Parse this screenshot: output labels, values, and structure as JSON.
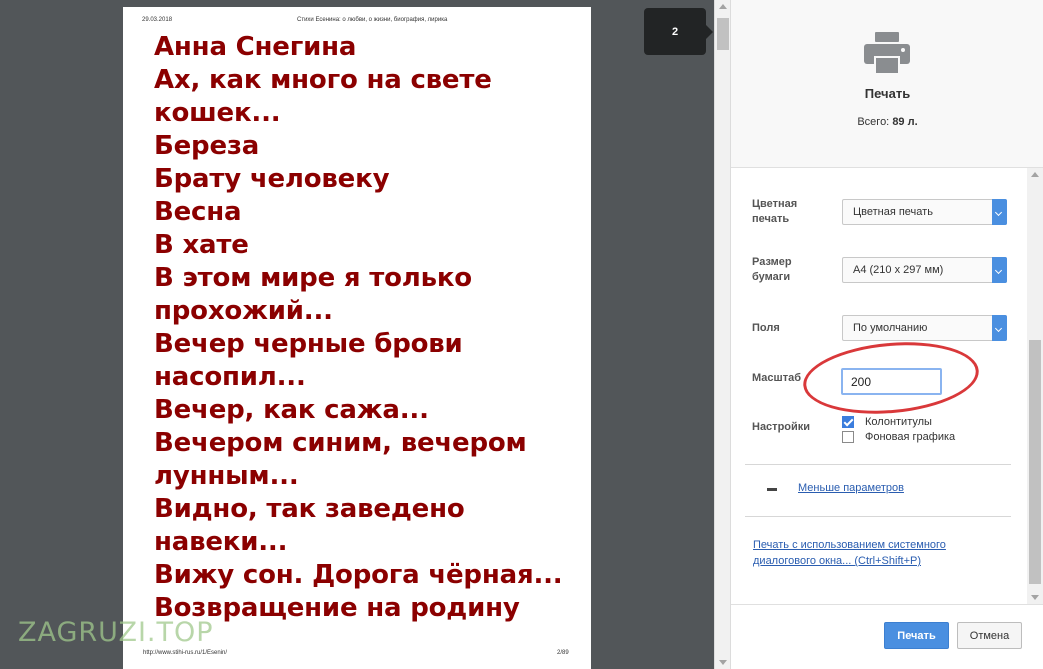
{
  "preview": {
    "header_date": "29.03.2018",
    "header_title": "Стихи Есенина: о любви, о жизни, биография, лирика",
    "poems": [
      "Анна Снегина",
      "Ах, как много на свете",
      "кошек...",
      "Береза",
      "Брату человеку",
      "Весна",
      "В хате",
      "В этом мире я только",
      "прохожий...",
      "Вечер черные брови",
      "насопил...",
      "Вечер, как сажа...",
      "Вечером синим, вечером",
      "лунным...",
      "Видно, так заведено",
      "навеки...",
      "Вижу сон. Дорога чёрная...",
      "Возвращение на родину"
    ],
    "footer_url": "http://www.stihi-rus.ru/1/Esenin/",
    "footer_page": "2/89",
    "page_badge": "2",
    "watermark": "ZAGRUZI.TOP",
    "text_color": "#8b0000"
  },
  "sidebar": {
    "icon": "printer-icon",
    "title": "Печать",
    "total_label": "Всего:",
    "total_value": "89 л.",
    "color_label": "Цветная печать",
    "color_value": "Цветная печать",
    "paper_label": "Размер бумаги",
    "paper_value": "A4 (210 x 297 мм)",
    "margins_label": "Поля",
    "margins_value": "По умолчанию",
    "scale_label": "Масштаб",
    "scale_value": "200",
    "settings_label": "Настройки",
    "opt_headers": "Колонтитулы",
    "opt_headers_checked": true,
    "opt_background": "Фоновая графика",
    "opt_background_checked": false,
    "less_settings": "Меньше параметров",
    "system_dialog_link": "Печать с использованием системного диалогового окна... (Ctrl+Shift+P)",
    "print_button": "Печать",
    "cancel_button": "Отмена",
    "accent_color": "#4a8fe0",
    "highlight_color": "#d9383a"
  }
}
